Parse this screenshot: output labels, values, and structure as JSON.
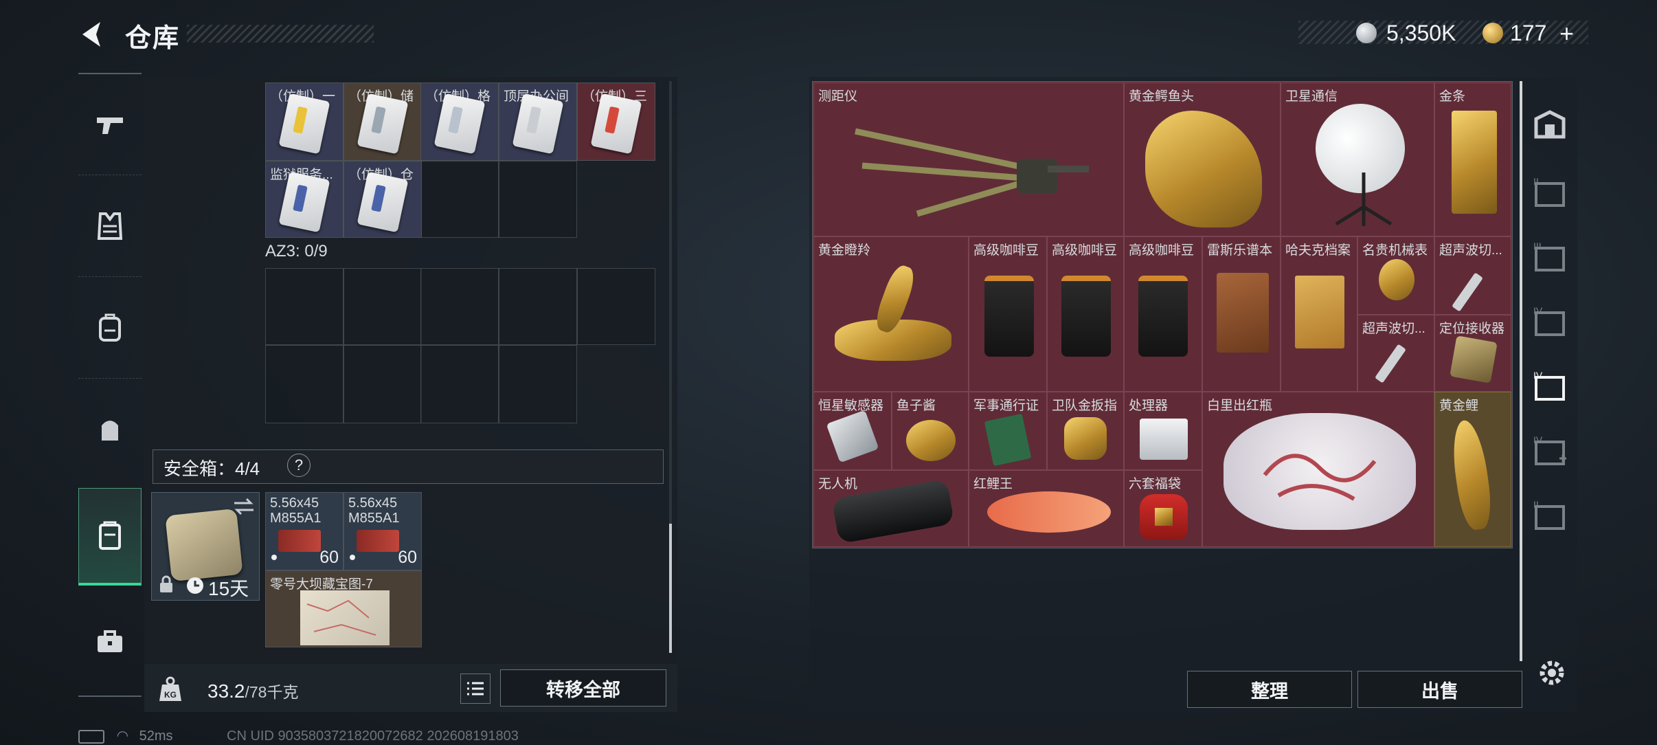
{
  "header": {
    "title": "仓库",
    "currency_silver": "5,350K",
    "currency_gold": "177",
    "currency_add": "+"
  },
  "left_nav": [
    {
      "name": "weapon"
    },
    {
      "name": "armor-vest"
    },
    {
      "name": "backpack"
    },
    {
      "name": "helmet"
    },
    {
      "name": "safe-box",
      "active": true
    },
    {
      "name": "toolbox"
    }
  ],
  "left_items": [
    {
      "label": "（仿制）一",
      "stripe": "#e9c23a"
    },
    {
      "label": "（仿制）储",
      "stripe": "#9aa6b2"
    },
    {
      "label": "（仿制）格",
      "stripe": "#b8c2cc"
    },
    {
      "label": "顶层办公间",
      "stripe": "#c9cdd1"
    },
    {
      "label": "（仿制）三",
      "stripe": "#d44a3a"
    },
    {
      "label": "监狱服务...",
      "stripe": "#4a62a8"
    },
    {
      "label": "（仿制）仓",
      "stripe": "#4a62a8"
    }
  ],
  "az3_label": "AZ3: 0/9",
  "safe": {
    "label": "安全箱：4/4",
    "help": "?",
    "days": "15天"
  },
  "safe_items": [
    {
      "name": "5.56x45\nM855A1",
      "count": "60"
    },
    {
      "name": "5.56x45\nM855A1",
      "count": "60"
    },
    {
      "name": "零号大坝藏宝图-7"
    }
  ],
  "weight": {
    "value": "33.2",
    "max": "/78千克"
  },
  "buttons": {
    "transfer_all": "转移全部",
    "organize": "整理",
    "sell": "出售"
  },
  "right_items": [
    {
      "label": "测距仪"
    },
    {
      "label": "黄金鳄鱼头"
    },
    {
      "label": "卫星通信"
    },
    {
      "label": "金条"
    },
    {
      "label": "黄金瞪羚"
    },
    {
      "label": "高级咖啡豆"
    },
    {
      "label": "高级咖啡豆"
    },
    {
      "label": "高级咖啡豆"
    },
    {
      "label": "雷斯乐谱本"
    },
    {
      "label": "哈夫克档案"
    },
    {
      "label": "名贵机械表"
    },
    {
      "label": "超声波切..."
    },
    {
      "label": "超声波切..."
    },
    {
      "label": "定位接收器"
    },
    {
      "label": "恒星敏感器"
    },
    {
      "label": "鱼子酱"
    },
    {
      "label": "军事通行证"
    },
    {
      "label": "卫队金扳指"
    },
    {
      "label": "处理器"
    },
    {
      "label": "白里出红瓶"
    },
    {
      "label": "黄金鲤"
    },
    {
      "label": "无人机"
    },
    {
      "label": "红鲤王"
    },
    {
      "label": "六套福袋"
    }
  ],
  "right_nav": [
    "vault",
    "shelf-II",
    "shelf-III",
    "shelf-IV-a",
    "shelf-IV-b",
    "shelf-IV-add",
    "shelf-II-b"
  ],
  "status": {
    "ping": "52ms",
    "uid": "CN UID 9035803721820072682 202608191803"
  },
  "colors": {
    "accent_green": "#37d79a",
    "rare_red": "#602b37"
  }
}
